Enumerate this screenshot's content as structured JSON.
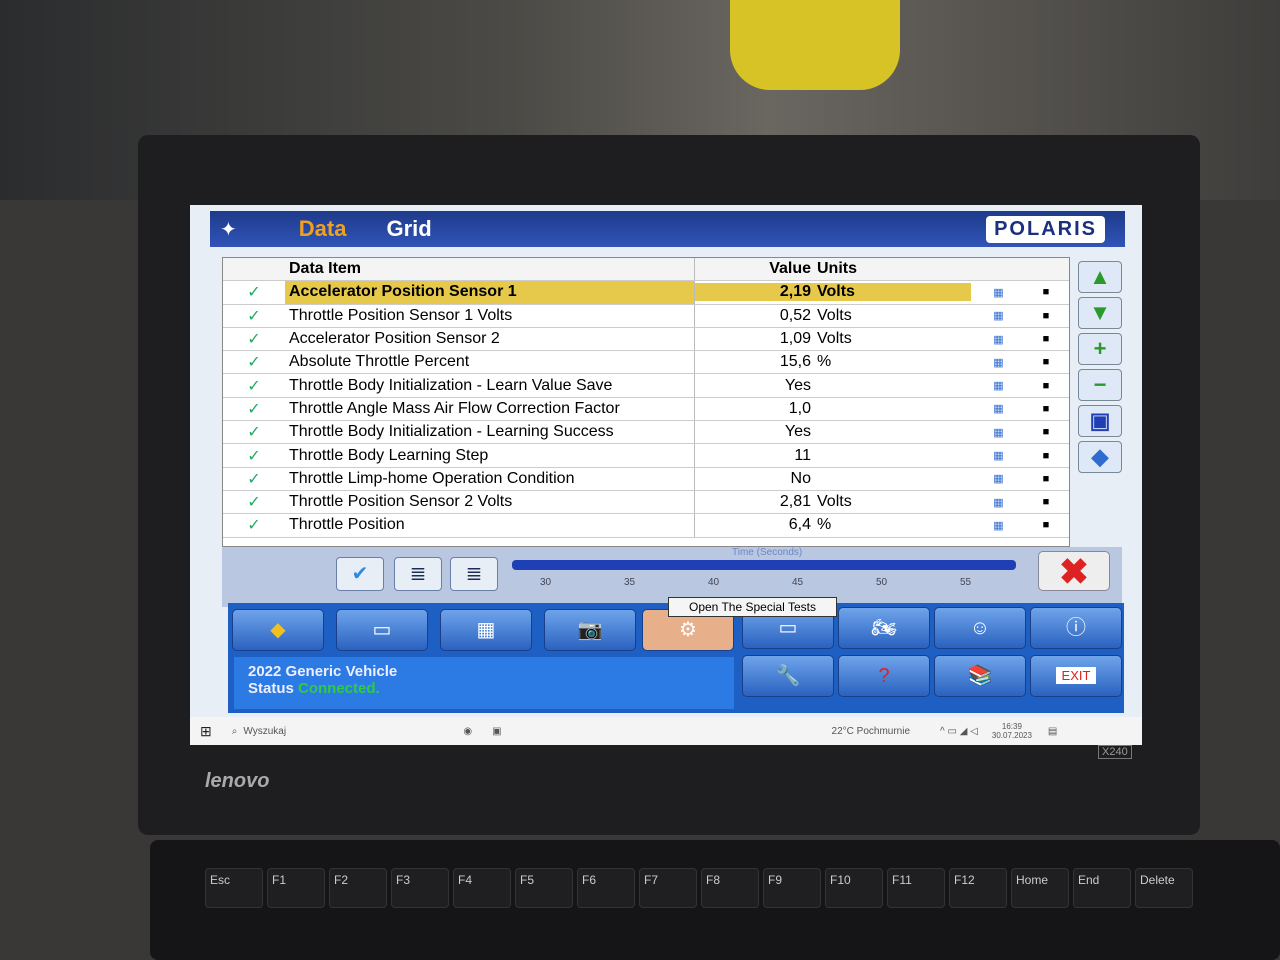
{
  "window": {
    "title_part1": "Data",
    "title_part2": "Grid",
    "brand": "POLARIS"
  },
  "grid": {
    "headers": {
      "item": "Data Item",
      "value": "Value",
      "units": "Units"
    },
    "rows": [
      {
        "name": "Accelerator Position Sensor 1",
        "value": "2,19",
        "unit": "Volts",
        "selected": true
      },
      {
        "name": "Throttle Position Sensor 1 Volts",
        "value": "0,52",
        "unit": "Volts"
      },
      {
        "name": "Accelerator Position Sensor 2",
        "value": "1,09",
        "unit": "Volts"
      },
      {
        "name": "Absolute Throttle Percent",
        "value": "15,6",
        "unit": "%"
      },
      {
        "name": "Throttle Body Initialization - Learn Value Save",
        "value": "Yes",
        "unit": ""
      },
      {
        "name": "Throttle Angle Mass Air Flow Correction Factor",
        "value": "1,0",
        "unit": ""
      },
      {
        "name": "Throttle Body Initialization - Learning Success",
        "value": "Yes",
        "unit": ""
      },
      {
        "name": "Throttle Body Learning Step",
        "value": "11",
        "unit": ""
      },
      {
        "name": "Throttle Limp-home Operation Condition",
        "value": "No",
        "unit": ""
      },
      {
        "name": "Throttle Position Sensor 2 Volts",
        "value": "2,81",
        "unit": "Volts"
      },
      {
        "name": "Throttle Position",
        "value": "6,4",
        "unit": "%"
      }
    ],
    "check_glyph": "✓"
  },
  "timeline": {
    "label": "Time (Seconds)",
    "ticks": [
      "30",
      "35",
      "40",
      "45",
      "50",
      "55"
    ]
  },
  "tooltip": "Open The Special Tests",
  "status": {
    "vehicle": "2022 Generic Vehicle",
    "label": "Status",
    "state": "Connected.",
    "state_color": "#2ecc40"
  },
  "exit_label": "EXIT",
  "taskbar": {
    "search": "Wyszukaj",
    "weather": "22°C  Pochmurnie",
    "time": "16:39",
    "date": "30.07.2023"
  },
  "laptop": {
    "brand": "lenovo",
    "model": "X240"
  },
  "keys": [
    "Esc",
    "F1",
    "F2",
    "F3",
    "F4",
    "F5",
    "F6",
    "F7",
    "F8",
    "F9",
    "F10",
    "F11",
    "F12",
    "Home",
    "End",
    "Delete"
  ]
}
